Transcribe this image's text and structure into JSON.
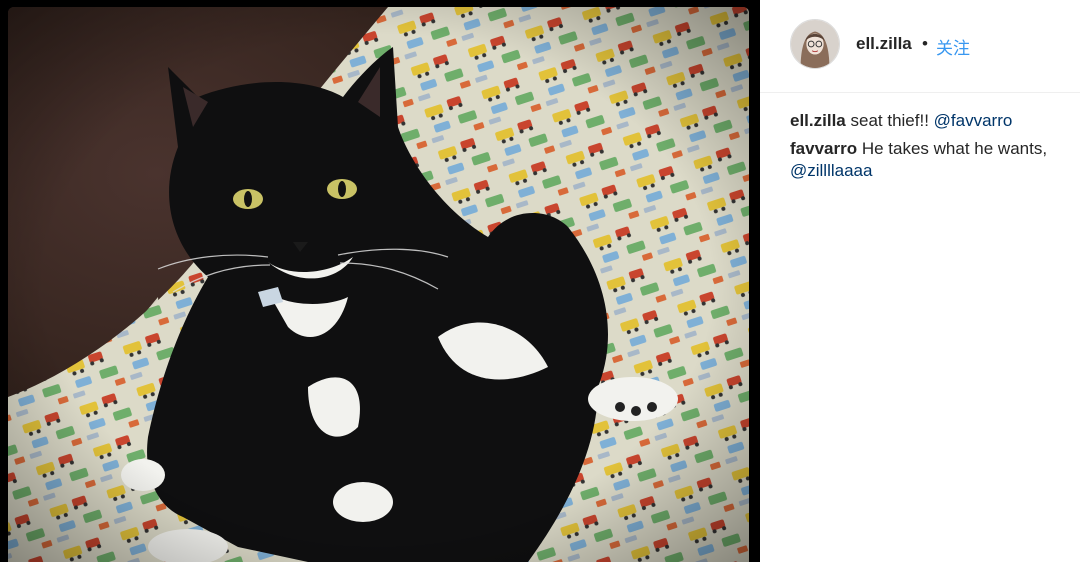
{
  "post": {
    "author": "ell.zilla",
    "separator": "•",
    "follow_label": "关注"
  },
  "comments": [
    {
      "user": "ell.zilla",
      "text": "seat thief!!",
      "mention": "@favvarro"
    },
    {
      "user": "favvarro",
      "text": "He takes what he wants,",
      "mention": "@zillllaaaa"
    }
  ],
  "colors": {
    "link_blue": "#3897f0",
    "mention_navy": "#003569",
    "text": "#262626"
  },
  "icons": {
    "avatar": "user-avatar-illustration"
  }
}
